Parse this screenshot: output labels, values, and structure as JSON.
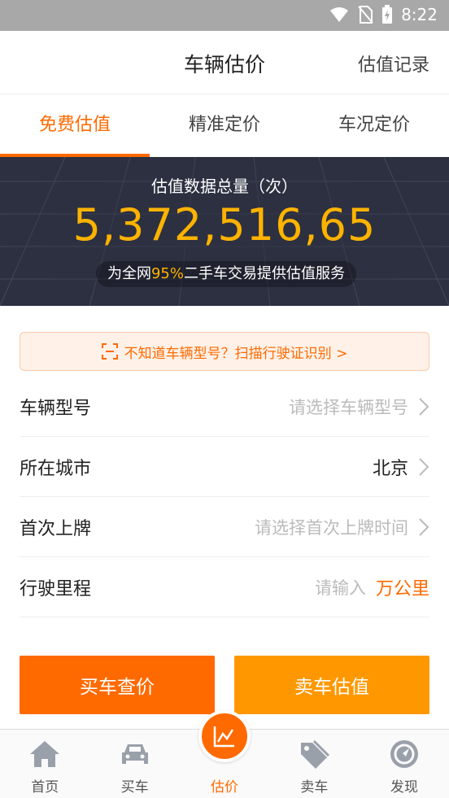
{
  "status_bar": {
    "time": "8:22"
  },
  "header": {
    "title": "车辆估价",
    "action": "估值记录"
  },
  "tabs": [
    {
      "label": "免费估值",
      "active": true
    },
    {
      "label": "精准定价",
      "active": false
    },
    {
      "label": "车况定价",
      "active": false
    }
  ],
  "banner": {
    "label": "估值数据总量（次）",
    "count": "5,372,516,65",
    "note_prefix": "为全网",
    "note_highlight": "95%",
    "note_suffix": "二手车交易提供估值服务"
  },
  "scan_hint": "不知道车辆型号？扫描行驶证识别 >",
  "form": {
    "model": {
      "label": "车辆型号",
      "placeholder": "请选择车辆型号"
    },
    "city": {
      "label": "所在城市",
      "value": "北京"
    },
    "first_reg": {
      "label": "首次上牌",
      "placeholder": "请选择首次上牌时间"
    },
    "mileage": {
      "label": "行驶里程",
      "placeholder": "请输入",
      "unit": "万公里"
    }
  },
  "buttons": {
    "buy": "买车查价",
    "sell": "卖车估值"
  },
  "nav": [
    {
      "label": "首页",
      "icon": "home-icon"
    },
    {
      "label": "买车",
      "icon": "car-icon"
    },
    {
      "label": "估价",
      "icon": "chart-icon",
      "active": true
    },
    {
      "label": "卖车",
      "icon": "tag-icon"
    },
    {
      "label": "发现",
      "icon": "compass-icon"
    }
  ],
  "colors": {
    "accent": "#ff6a00",
    "accent_secondary": "#ff9800",
    "banner_bg": "#2c3040",
    "highlight": "#ffb300"
  }
}
